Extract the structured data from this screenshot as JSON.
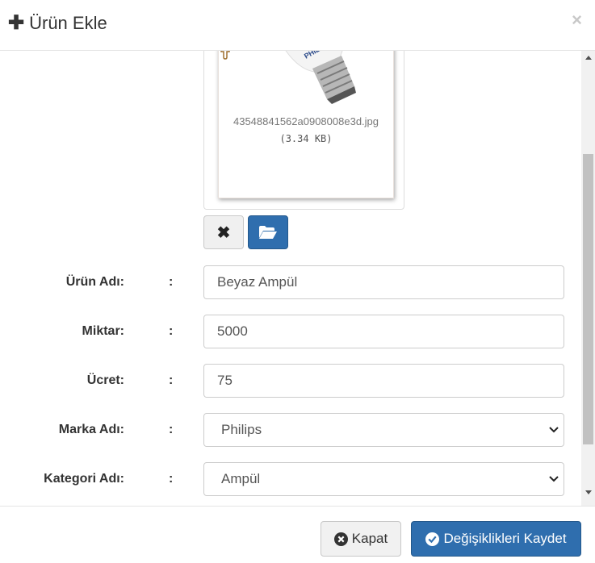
{
  "modal": {
    "title": "Ürün Ekle",
    "close_glyph": "×"
  },
  "upload": {
    "file_name": "43548841562a0908008e3d.jpg",
    "file_size": "(3.34 KB)",
    "brand_print": "PHILIPS",
    "remove_glyph": "✖"
  },
  "form": {
    "fields": [
      {
        "label": "Ürün Adı:",
        "colon": ":",
        "value": "Beyaz Ampül"
      },
      {
        "label": "Miktar:",
        "colon": ":",
        "value": "5000"
      },
      {
        "label": "Ücret:",
        "colon": ":",
        "value": "75"
      },
      {
        "label": "Marka Adı:",
        "colon": ":",
        "value": "Philips"
      },
      {
        "label": "Kategori Adı:",
        "colon": ":",
        "value": "Ampül"
      }
    ]
  },
  "footer": {
    "close_label": "Kapat",
    "save_label": "Değişiklikleri Kaydet"
  },
  "colors": {
    "primary": "#2f6eae",
    "border": "#cccccc",
    "scroll_thumb": "#c1c1c1"
  },
  "icons": {
    "title": "plus-icon",
    "close": "close-icon",
    "remove": "times-icon",
    "browse": "folder-open-icon",
    "drag": "drag-hand-icon",
    "select": "chevron-down-icon",
    "kapat": "times-circle-icon",
    "save": "check-circle-icon"
  }
}
